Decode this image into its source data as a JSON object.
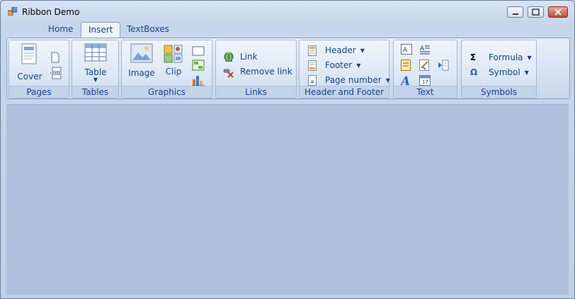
{
  "window": {
    "title": "Ribbon Demo"
  },
  "tabs": [
    {
      "label": "Home"
    },
    {
      "label": "Insert"
    },
    {
      "label": "TextBoxes"
    }
  ],
  "groups": {
    "pages": {
      "label": "Pages",
      "cover": "Cover"
    },
    "tables": {
      "label": "Tables",
      "table": "Table"
    },
    "graphics": {
      "label": "Graphics",
      "image": "Image",
      "clip": "Clip"
    },
    "links": {
      "label": "Links",
      "link": "Link",
      "remove_link": "Remove link"
    },
    "header_footer": {
      "label": "Header and Footer",
      "header": "Header",
      "footer": "Footer",
      "page_number": "Page number"
    },
    "text": {
      "label": "Text"
    },
    "symbols": {
      "label": "Symbols",
      "formula": "Formula",
      "symbol": "Symbol",
      "formula_glyph": "Σ",
      "symbol_glyph": "Ω"
    }
  },
  "colors": {
    "accent": "#15428b",
    "workspace": "#adc1dd",
    "ribbon": "#dbe6f4"
  }
}
